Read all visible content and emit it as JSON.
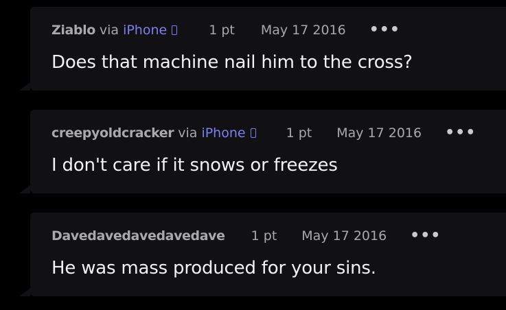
{
  "comments": [
    {
      "username": "Ziablo",
      "via": "via",
      "device": "iPhone",
      "points": "1 pt",
      "date": "May 17 2016",
      "more": "•••",
      "text": "Does that machine nail him to the cross?"
    },
    {
      "username": "creepyoldcracker",
      "via": "via",
      "device": "iPhone",
      "points": "1 pt",
      "date": "May 17 2016",
      "more": "•••",
      "text": "I don't care if it snows or freezes"
    },
    {
      "username": "Davedavedavedavedave",
      "points": "1 pt",
      "date": "May 17 2016",
      "more": "•••",
      "text": "He was mass produced for your sins."
    }
  ],
  "colors": {
    "background": "#000000",
    "card": "#111114",
    "meta_text": "#a8a8ad",
    "device_link": "#7d7ff0",
    "body_text": "#f2f2f2"
  },
  "icons": {
    "device": "phone-icon",
    "more": "more-options-icon"
  }
}
